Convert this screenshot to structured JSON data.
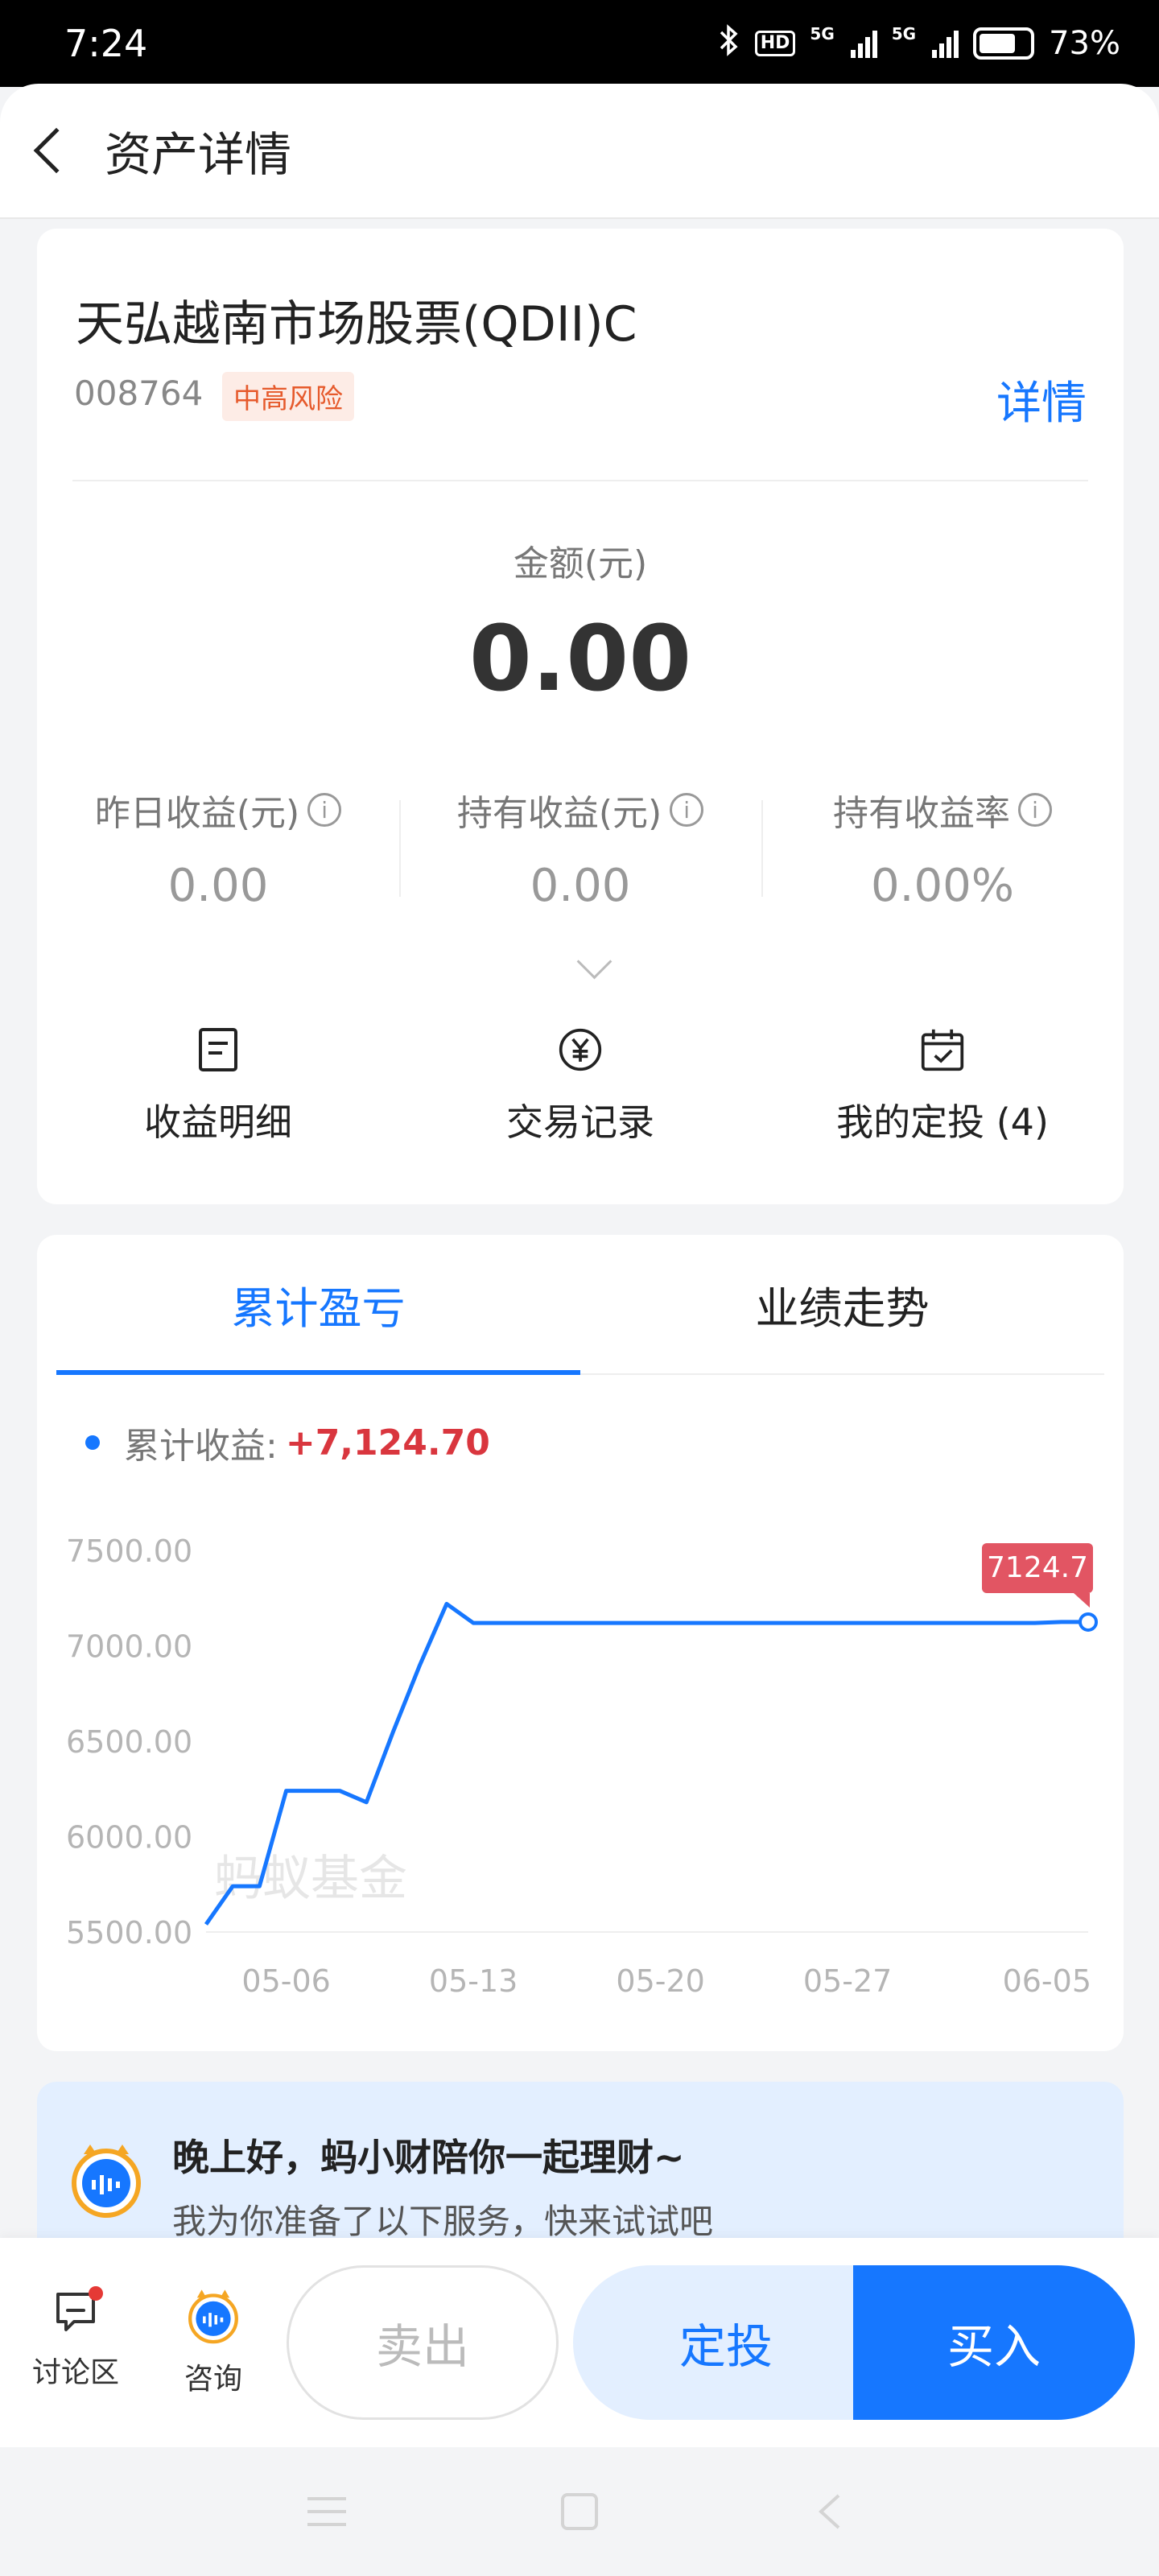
{
  "status_bar": {
    "time": "7:24",
    "hd_label": "HD",
    "network_1": "5G",
    "network_2": "5G",
    "battery": "73%"
  },
  "header": {
    "title": "资产详情"
  },
  "fund": {
    "name": "天弘越南市场股票(QDII)C",
    "code": "008764",
    "risk": "中高风险",
    "detail_link": "详情",
    "amount_label": "金额(元)",
    "amount_value": "0.00",
    "stats": [
      {
        "label": "昨日收益(元)",
        "value": "0.00"
      },
      {
        "label": "持有收益(元)",
        "value": "0.00"
      },
      {
        "label": "持有收益率",
        "value": "0.00%"
      }
    ],
    "actions": [
      {
        "label": "收益明细",
        "icon": "document-icon"
      },
      {
        "label": "交易记录",
        "icon": "yuan-icon"
      },
      {
        "label": "我的定投 (4)",
        "icon": "calendar-check-icon"
      }
    ]
  },
  "chart_tabs": [
    {
      "label": "累计盈亏",
      "active": true
    },
    {
      "label": "业绩走势",
      "active": false
    }
  ],
  "legend": {
    "label": "累计收益:",
    "value": "+7,124.70"
  },
  "watermark": "蚂蚁基金",
  "chart_data": {
    "type": "line",
    "x": [
      "05-03",
      "05-04",
      "05-05",
      "05-06",
      "05-07",
      "05-08",
      "05-09",
      "05-10",
      "05-11",
      "05-12",
      "05-13",
      "05-14",
      "05-15",
      "05-16",
      "05-17",
      "05-18",
      "05-19",
      "05-20",
      "05-21",
      "05-22",
      "05-23",
      "05-24",
      "05-25",
      "05-26",
      "05-27",
      "05-28",
      "05-29",
      "05-30",
      "05-31",
      "06-01",
      "06-02",
      "06-03",
      "06-04",
      "06-05"
    ],
    "values": [
      5540,
      5740,
      5740,
      6240,
      6240,
      6240,
      6180,
      6550,
      6900,
      7220,
      7120,
      7120,
      7120,
      7120,
      7120,
      7120,
      7120,
      7120,
      7120,
      7120,
      7120,
      7120,
      7120,
      7120,
      7120,
      7120,
      7120,
      7120,
      7120,
      7120,
      7120,
      7120,
      7124.7,
      7124.7
    ],
    "x_tick_labels": [
      "05-06",
      "05-13",
      "05-20",
      "05-27",
      "06-05"
    ],
    "y_tick_labels": [
      "7500.00",
      "7000.00",
      "6500.00",
      "6000.00",
      "5500.00"
    ],
    "ylim": [
      5500,
      7500
    ],
    "last_point_label": "7124.7",
    "line_color": "#1677ff",
    "marker_color": "#e25563",
    "grid": false
  },
  "service": {
    "greeting": "晚上好，蚂小财陪你一起理财~",
    "sub": "我为你准备了以下服务，快来试试吧"
  },
  "bottom_bar": {
    "discuss_label": "讨论区",
    "consult_label": "咨询",
    "sell_label": "卖出",
    "sip_label": "定投",
    "buy_label": "买入"
  },
  "colors": {
    "accent": "#1677ff",
    "risk": "#e65a2c",
    "gain": "#d9363e"
  }
}
